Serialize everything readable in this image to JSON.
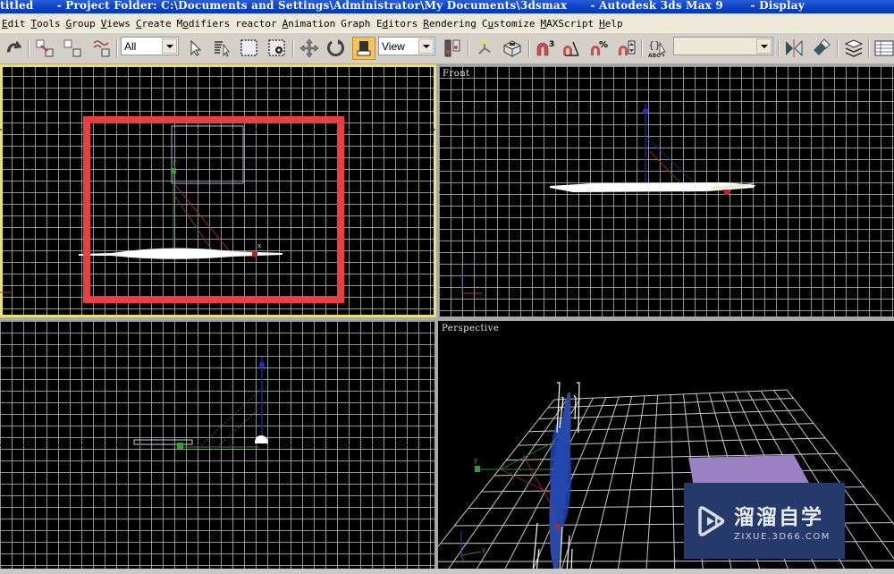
{
  "titlebar": {
    "text": "titled      - Project Folder: C:\\Documents and Settings\\Administrator\\My Documents\\3dsmax      - Autodesk 3ds Max 9       - Display"
  },
  "menubar": {
    "items": [
      {
        "pre": "",
        "u": "E",
        "post": "dit"
      },
      {
        "pre": "",
        "u": "T",
        "post": "ools"
      },
      {
        "pre": "",
        "u": "G",
        "post": "roup"
      },
      {
        "pre": "",
        "u": "V",
        "post": "iews"
      },
      {
        "pre": "",
        "u": "C",
        "post": "reate"
      },
      {
        "pre": "M",
        "u": "o",
        "post": "difiers"
      },
      {
        "pre": "reactor",
        "u": "",
        "post": ""
      },
      {
        "pre": "",
        "u": "A",
        "post": "nimation"
      },
      {
        "pre": "Graph E",
        "u": "d",
        "post": "itors"
      },
      {
        "pre": "",
        "u": "R",
        "post": "endering"
      },
      {
        "pre": "C",
        "u": "u",
        "post": "stomize"
      },
      {
        "pre": "",
        "u": "M",
        "post": "AXScript"
      },
      {
        "pre": "",
        "u": "H",
        "post": "elp"
      }
    ]
  },
  "toolbar": {
    "selection_filter": "All",
    "reference_coord_system": "View",
    "named_selection_sets": "",
    "icons": [
      "redo-icon",
      "select-and-link-icon",
      "unlink-selection-icon",
      "bind-to-space-warp-icon",
      "select-object-icon",
      "select-by-name-icon",
      "rectangular-selection-region-icon",
      "window-crossing-icon",
      "select-and-move-icon",
      "select-and-rotate-icon",
      "select-and-scale-icon",
      "use-pivot-point-center-icon",
      "select-and-manipulate-icon",
      "keyboard-shortcut-override-icon",
      "snaps-toggle-icon",
      "angle-snap-toggle-icon",
      "percent-snap-toggle-icon",
      "spinner-snap-toggle-icon",
      "edit-named-selection-sets-icon",
      "mirror-icon",
      "align-icon",
      "layer-manager-icon",
      "curve-editor-icon"
    ]
  },
  "viewports": {
    "top_left": {
      "label": "",
      "active": true
    },
    "top_right": {
      "label": "Front"
    },
    "bottom_left": {
      "label": ""
    },
    "bottom_right": {
      "label": "Perspective"
    }
  },
  "annotation": {
    "color": "#e84040"
  },
  "watermark": {
    "brand_cn": "溜溜自学",
    "url": "ZIXUE.3D66.COM"
  }
}
